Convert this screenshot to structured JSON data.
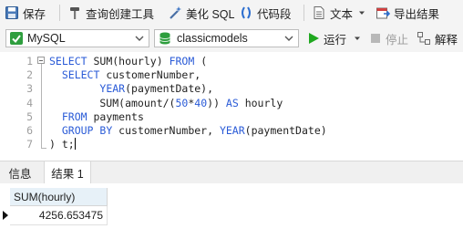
{
  "toolbar": {
    "save": "保存",
    "query_builder": "查询创建工具",
    "beautify_sql": "美化 SQL",
    "code_snippet": "代码段",
    "text": "文本",
    "export_results": "导出结果"
  },
  "toolbar2": {
    "connection": "MySQL",
    "database": "classicmodels",
    "run": "运行",
    "stop": "停止",
    "explain": "解释"
  },
  "editor": {
    "line_numbers": [
      "1",
      "2",
      "3",
      "4",
      "5",
      "6",
      "7"
    ]
  },
  "tabs": {
    "info": "信息",
    "result1": "结果 1"
  },
  "result": {
    "column": "SUM(hourly)",
    "value": "4256.653475"
  },
  "colors": {
    "keyword": "#2a5bd7",
    "run_green": "#1fa81f",
    "db_green": "#2e9e3e",
    "grid_header_bg": "#e7f1f8"
  }
}
